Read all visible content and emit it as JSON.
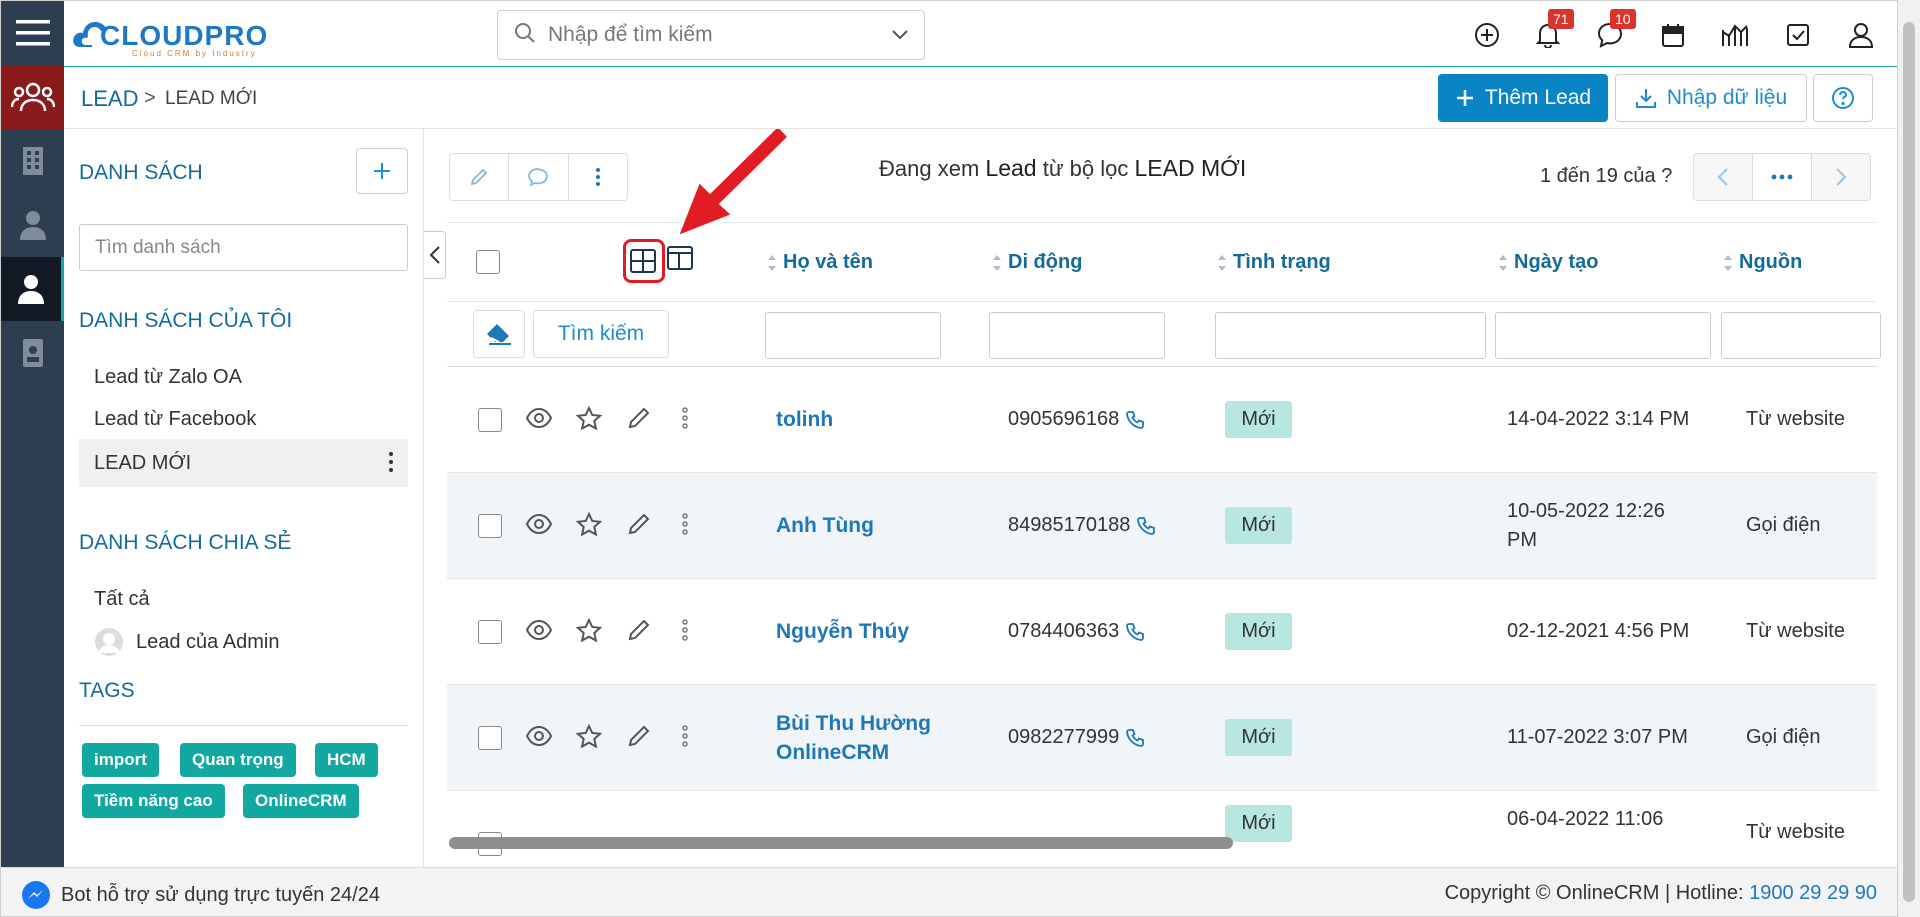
{
  "header": {
    "logo_text": "CLOUDPRO",
    "logo_tagline": "Cloud CRM by Industry",
    "search_placeholder": "Nhập để tìm kiếm",
    "notifications_count": "71",
    "messages_count": "10"
  },
  "breadcrumb": {
    "module": "LEAD",
    "separator": ">",
    "current": "LEAD MỚI"
  },
  "actions": {
    "add_lead": "Thêm Lead",
    "import": "Nhập dữ liệu"
  },
  "sidebar": {
    "list_title": "DANH SÁCH",
    "search_placeholder": "Tìm danh sách",
    "my_lists_title": "DANH SÁCH CỦA TÔI",
    "my_lists": [
      {
        "label": "Lead từ Zalo OA"
      },
      {
        "label": "Lead từ Facebook"
      },
      {
        "label": "LEAD MỚI"
      }
    ],
    "shared_title": "DANH SÁCH CHIA SẺ",
    "shared_lists": [
      {
        "label": "Tất cả"
      },
      {
        "label": "Lead của Admin"
      }
    ],
    "tags_title": "TAGS",
    "tags": [
      "import",
      "Quan trọng",
      "HCM",
      "Tiềm năng cao",
      "OnlineCRM"
    ]
  },
  "main": {
    "view_info_prefix": "Đang xem",
    "view_info_module": "Lead",
    "view_info_middle": "từ bộ lọc",
    "view_info_filter": "LEAD MỚI",
    "page_info": "1 đến 19 của ?",
    "filter_search_label": "Tìm kiếm",
    "columns": [
      "Họ và tên",
      "Di động",
      "Tình trạng",
      "Ngày tạo",
      "Nguồn"
    ],
    "rows": [
      {
        "name": "tolinh",
        "phone": "0905696168",
        "status": "Mới",
        "created": "14-04-2022 3:14 PM",
        "source": "Từ website"
      },
      {
        "name": "Anh Tùng",
        "phone": "84985170188",
        "status": "Mới",
        "created": "10-05-2022 12:26 PM",
        "source": "Gọi điện"
      },
      {
        "name": "Nguyễn Thúy",
        "phone": "0784406363",
        "status": "Mới",
        "created": "02-12-2021 4:56 PM",
        "source": "Từ website"
      },
      {
        "name": "Bùi Thu Hường OnlineCRM",
        "phone": "0982277999",
        "status": "Mới",
        "created": "11-07-2022 3:07 PM",
        "source": "Gọi điện"
      },
      {
        "name": "",
        "phone": "",
        "status": "Mới",
        "created": "06-04-2022 11:06",
        "source": "Từ website"
      }
    ]
  },
  "footer": {
    "chat_label": "Bot hỗ trợ sử dụng trực tuyến 24/24",
    "copyright": "Copyright © OnlineCRM | Hotline:",
    "hotline": "1900 29 29 90"
  },
  "colors": {
    "primary": "#0b84c6",
    "link": "#146b9a",
    "tag": "#12a7a0",
    "status_bg": "#b7e7e0",
    "rail": "#2d3e50",
    "rail_active_red": "#8b1a1a",
    "annotation_red": "#e11c24"
  }
}
